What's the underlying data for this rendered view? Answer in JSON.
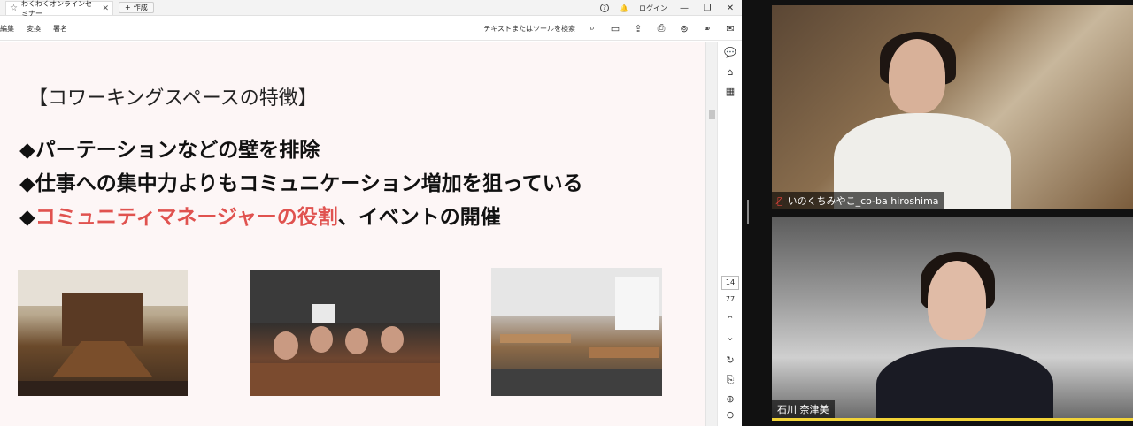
{
  "tab": {
    "title": "わくわくオンラインセミナー",
    "new_tab_label": "作成"
  },
  "titlebar": {
    "login_label": "ログイン"
  },
  "menu": [
    "編集",
    "変換",
    "署名"
  ],
  "toolbar": {
    "search_placeholder": "テキストまたはツールを検索"
  },
  "slide": {
    "title": "【コワーキングスペースの特徴】",
    "bullets": [
      {
        "marker": "◆",
        "text": "パーテーションなどの壁を排除",
        "highlight": "",
        "rest": ""
      },
      {
        "marker": "◆",
        "text": "仕事への集中力よりもコミュニケーション増加を狙っている",
        "highlight": "",
        "rest": ""
      },
      {
        "marker": "◆",
        "text": "",
        "highlight": "コミュニティマネージャーの役割",
        "rest": "、イベントの開催"
      }
    ]
  },
  "page_nav": {
    "current": "14",
    "total": "77"
  },
  "participants": [
    {
      "name": "いのくちみやこ_co-ba hiroshima",
      "muted": true
    },
    {
      "name": "石川 奈津美",
      "muted": false
    }
  ],
  "colors": {
    "highlight": "#e0524f",
    "active_speaker": "#f2d337"
  }
}
